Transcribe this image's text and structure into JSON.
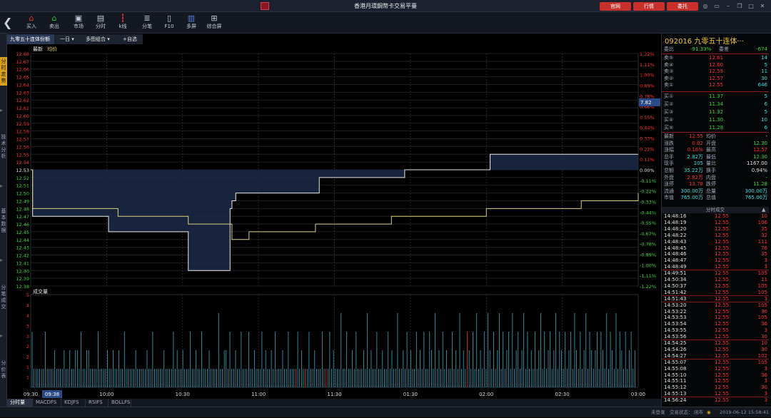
{
  "titlebar": {
    "title": "香港月環鋼幣卡交易平臺",
    "btn_official": "官网",
    "btn_market": "行情",
    "btn_trade": "委托"
  },
  "toolbar": [
    {
      "label": "买入",
      "icon": "buy-icon",
      "color": "#e83030"
    },
    {
      "label": "卖出",
      "icon": "sell-icon",
      "color": "#30c030"
    },
    {
      "label": "市场",
      "icon": "market-icon",
      "color": "#c0c8d8"
    },
    {
      "label": "分时",
      "icon": "timeline-icon",
      "color": "#c0c8d8"
    },
    {
      "label": "k线",
      "icon": "candlestick-icon",
      "color": "#e83030"
    },
    {
      "label": "分笔",
      "icon": "ticks-icon",
      "color": "#c0c8d8"
    },
    {
      "label": "F10",
      "icon": "f10-icon",
      "color": "#c0c8d8"
    },
    {
      "label": "多屏",
      "icon": "multiscreen-icon",
      "color": "#5080e0"
    },
    {
      "label": "综合屏",
      "icon": "composite-icon",
      "color": "#c0c8d8"
    }
  ],
  "leftnav": [
    "分时走势",
    "技术分析",
    "基本数据",
    "分笔成交",
    "分价表"
  ],
  "chart_header": {
    "name": "九零五十连体份额",
    "period": "一日",
    "combo": "多图组合",
    "add": "+自选"
  },
  "legend": {
    "latest": "最新",
    "avg": "均价"
  },
  "volume_label": "成交量",
  "cursor_value": "7.82",
  "time_cursor": "09:38",
  "chart_data": {
    "type": "line",
    "price_ticks": [
      "12.68",
      "12.67",
      "12.66",
      "12.65",
      "12.64",
      "12.63",
      "12.62",
      "12.61",
      "12.60",
      "12.59",
      "12.58",
      "12.57",
      "12.56",
      "12.55",
      "12.54",
      "12.53",
      "12.52",
      "12.51",
      "12.50",
      "12.49",
      "12.48",
      "12.47",
      "12.46",
      "12.45",
      "12.44",
      "12.43",
      "12.42",
      "12.41",
      "12.40",
      "12.39",
      "12.38"
    ],
    "pct_ticks": [
      "1.22%",
      "1.11%",
      "1.00%",
      "0.89%",
      "0.78%",
      "0.66%",
      "0.55%",
      "0.44%",
      "0.33%",
      "0.22%",
      "0.11%",
      "0.00%",
      "-0.11%",
      "-0.22%",
      "-0.33%",
      "-0.44%",
      "-0.55%",
      "-0.67%",
      "-0.78%",
      "-0.89%",
      "-1.00%",
      "-1.11%",
      "-1.22%"
    ],
    "vol_ticks": [
      "5",
      "4",
      "4",
      "3",
      "3",
      "2",
      "2",
      "1",
      "1"
    ],
    "xticks": [
      "09:30",
      "10:00",
      "10:30",
      "11:00",
      "11:30",
      "01:30",
      "02:00",
      "02:30",
      "03:00"
    ],
    "ylim": [
      12.38,
      12.68
    ],
    "series": [
      {
        "color": "#e8e8e8",
        "values": [
          [
            0,
            12.53
          ],
          [
            1,
            12.47
          ],
          [
            40,
            12.47
          ],
          [
            41,
            12.45
          ],
          [
            82,
            12.45
          ],
          [
            83,
            12.4
          ],
          [
            104,
            12.4
          ],
          [
            105,
            12.48
          ],
          [
            106,
            12.49
          ],
          [
            108,
            12.5
          ],
          [
            150,
            12.5
          ],
          [
            152,
            12.52
          ],
          [
            195,
            12.52
          ],
          [
            197,
            12.53
          ],
          [
            240,
            12.53
          ],
          [
            242,
            12.55
          ],
          [
            320,
            12.55
          ]
        ]
      },
      {
        "color": "#d8d080",
        "values": [
          [
            0,
            12.53
          ],
          [
            1,
            12.48
          ],
          [
            40,
            12.48
          ],
          [
            46,
            12.47
          ],
          [
            70,
            12.47
          ],
          [
            83,
            12.46
          ],
          [
            104,
            12.46
          ],
          [
            106,
            12.44
          ],
          [
            115,
            12.45
          ],
          [
            150,
            12.46
          ],
          [
            190,
            12.47
          ],
          [
            240,
            12.48
          ],
          [
            290,
            12.49
          ],
          [
            320,
            12.5
          ]
        ]
      }
    ],
    "volume": [
      3,
      1,
      1,
      1,
      1,
      1,
      1,
      3,
      1,
      1,
      1,
      1,
      2,
      1,
      1,
      1,
      1,
      2,
      1,
      1,
      2,
      1,
      1,
      2,
      2,
      1,
      3,
      1,
      1,
      2,
      2,
      1,
      1,
      1,
      1,
      3,
      1,
      1,
      1,
      1,
      2,
      1,
      1,
      2,
      1,
      1,
      2,
      1,
      1,
      3,
      1,
      1,
      1,
      1,
      1,
      2,
      1,
      1,
      1,
      1,
      1,
      2,
      1,
      1,
      3,
      1,
      1,
      1,
      1,
      1,
      2,
      1,
      1,
      1,
      1,
      3,
      1,
      2,
      1,
      1,
      2,
      1,
      1,
      1,
      3,
      1,
      1,
      2,
      1,
      1,
      3,
      1,
      1,
      1,
      2,
      1,
      1,
      1,
      1,
      4,
      1,
      1,
      2,
      2,
      1,
      3,
      1,
      1,
      2,
      1,
      1,
      3,
      1,
      1,
      1,
      3,
      1,
      1,
      2,
      1,
      1,
      1,
      3,
      1,
      2,
      1,
      1,
      2,
      1,
      3,
      1,
      1,
      1,
      2,
      1,
      1,
      3,
      1,
      1,
      1,
      1,
      3,
      1,
      2,
      1,
      1,
      1,
      3,
      1,
      1,
      2,
      1,
      1,
      1,
      3,
      1,
      1,
      1,
      3,
      1,
      2,
      1,
      1,
      1,
      4,
      1,
      1,
      3,
      1,
      1,
      2,
      1,
      3,
      1,
      1,
      1,
      2,
      1,
      4,
      1,
      2,
      1,
      1,
      3,
      1,
      1,
      2,
      1,
      1,
      3,
      1,
      2,
      1,
      1,
      4,
      1,
      1,
      2,
      1,
      3,
      1,
      2,
      1,
      1,
      3,
      1,
      2,
      1,
      3,
      1,
      1,
      3,
      2,
      1,
      4,
      1,
      2,
      1,
      3,
      1,
      2,
      1,
      1,
      3,
      1,
      2,
      1,
      4,
      1,
      2,
      1,
      3,
      2,
      1,
      3,
      1,
      4,
      1,
      2,
      1,
      3,
      1,
      4,
      2,
      1,
      3,
      1,
      2,
      4,
      1,
      3,
      1,
      2,
      3,
      1,
      4,
      1,
      2,
      3,
      1,
      2,
      4,
      1,
      3,
      1,
      2,
      1,
      3,
      1,
      2,
      4,
      1,
      3,
      1,
      2,
      3,
      1,
      2,
      4,
      1,
      3,
      2,
      1,
      3,
      1,
      2,
      3,
      1,
      4,
      2,
      1,
      3,
      1,
      2,
      4,
      1,
      3,
      2,
      1,
      2,
      3,
      1,
      3,
      2,
      1,
      4,
      1,
      3,
      2,
      1,
      4,
      1,
      3,
      2,
      1,
      3,
      1,
      2,
      3,
      1,
      2
    ]
  },
  "right": {
    "code_name": "092016 九零五十连体···",
    "weibi": {
      "label": "委比",
      "value": "-91.33%",
      "label2": "委差",
      "value2": "-674"
    },
    "sells": [
      {
        "label": "卖⑤",
        "price": "12.61",
        "vol": "14"
      },
      {
        "label": "卖④",
        "price": "12.60",
        "vol": "5"
      },
      {
        "label": "卖③",
        "price": "12.59",
        "vol": "11"
      },
      {
        "label": "卖②",
        "price": "12.57",
        "vol": "30"
      },
      {
        "label": "卖①",
        "price": "12.55",
        "vol": "646"
      }
    ],
    "buys": [
      {
        "label": "买①",
        "price": "11.37",
        "vol": "5"
      },
      {
        "label": "买②",
        "price": "11.34",
        "vol": "6"
      },
      {
        "label": "买③",
        "price": "11.32",
        "vol": "5"
      },
      {
        "label": "买④",
        "price": "11.30",
        "vol": "10"
      },
      {
        "label": "买⑤",
        "price": "11.28",
        "vol": "6"
      }
    ],
    "stats": [
      {
        "l1": "最新",
        "v1": "12.55",
        "c1": "red",
        "l2": "均价",
        "v2": "-",
        "c2": "white"
      },
      {
        "l1": "涨跌",
        "v1": "0.02",
        "c1": "red",
        "l2": "开盘",
        "v2": "12.30",
        "c2": "green"
      },
      {
        "l1": "涨幅",
        "v1": "0.16%",
        "c1": "red",
        "l2": "最高",
        "v2": "12.57",
        "c2": "red"
      },
      {
        "l1": "总手",
        "v1": "2.82万",
        "c1": "cyan",
        "l2": "最低",
        "v2": "12.30",
        "c2": "green"
      },
      {
        "l1": "现手",
        "v1": "105",
        "c1": "cyan",
        "l2": "量比",
        "v2": "1167.00",
        "c2": "white"
      },
      {
        "l1": "总额",
        "v1": "35.22万",
        "c1": "cyan",
        "l2": "换手",
        "v2": "0.94%",
        "c2": "white"
      },
      {
        "l1": "外盘",
        "v1": "2.82万",
        "c1": "red",
        "l2": "内盘",
        "v2": "-",
        "c2": "green"
      },
      {
        "l1": "涨停",
        "v1": "13.78",
        "c1": "red",
        "l2": "跌停",
        "v2": "11.28",
        "c2": "green"
      },
      {
        "l1": "流通",
        "v1": "300.00万",
        "c1": "cyan",
        "l2": "总量",
        "v2": "300.00万",
        "c2": "cyan"
      },
      {
        "l1": "市值",
        "v1": "765.00万",
        "c1": "cyan",
        "l2": "总值",
        "v2": "765.00万",
        "c2": "cyan"
      }
    ],
    "trades_header": "分时成交",
    "trades": [
      {
        "t": "14:48:16",
        "p": "12.55",
        "v": "10"
      },
      {
        "t": "14:48:19",
        "p": "12.55",
        "v": "106"
      },
      {
        "t": "14:48:20",
        "p": "12.55",
        "v": "35"
      },
      {
        "t": "14:48:22",
        "p": "12.55",
        "v": "32"
      },
      {
        "t": "14:48:43",
        "p": "12.55",
        "v": "111"
      },
      {
        "t": "14:48:45",
        "p": "12.55",
        "v": "76"
      },
      {
        "t": "14:48:46",
        "p": "12.55",
        "v": "35"
      },
      {
        "t": "14:48:47",
        "p": "12.55",
        "v": "3"
      },
      {
        "t": "14:48:49",
        "p": "12.55",
        "v": "3"
      },
      {
        "t": "14:49:51",
        "p": "12.55",
        "v": "105"
      },
      {
        "t": "14:50:34",
        "p": "12.55",
        "v": "11"
      },
      {
        "t": "14:50:37",
        "p": "12.55",
        "v": "105"
      },
      {
        "t": "14:51:42",
        "p": "12.55",
        "v": "105"
      },
      {
        "t": "14:51:43",
        "p": "12.55",
        "v": "3"
      },
      {
        "t": "14:53:20",
        "p": "12.55",
        "v": "105"
      },
      {
        "t": "14:53:22",
        "p": "12.55",
        "v": "30"
      },
      {
        "t": "14:53:53",
        "p": "12.55",
        "v": "105"
      },
      {
        "t": "14:53:54",
        "p": "12.55",
        "v": "36"
      },
      {
        "t": "14:53:55",
        "p": "12.55",
        "v": "3"
      },
      {
        "t": "14:53:56",
        "p": "12.55",
        "v": "30"
      },
      {
        "t": "14:54:25",
        "p": "12.55",
        "v": "10"
      },
      {
        "t": "14:54:26",
        "p": "12.55",
        "v": "30"
      },
      {
        "t": "14:54:27",
        "p": "12.55",
        "v": "102"
      },
      {
        "t": "14:55:07",
        "p": "12.55",
        "v": "105"
      },
      {
        "t": "14:55:08",
        "p": "12.55",
        "v": "3"
      },
      {
        "t": "14:55:10",
        "p": "12.55",
        "v": "36"
      },
      {
        "t": "14:55:11",
        "p": "12.55",
        "v": "3"
      },
      {
        "t": "14:55:12",
        "p": "12.55",
        "v": "30"
      },
      {
        "t": "14:55:13",
        "p": "12.55",
        "v": "3"
      },
      {
        "t": "14:56:24",
        "p": "12.55",
        "v": "3"
      }
    ]
  },
  "bottom_tabs": [
    "分时量",
    "MACDFS",
    "KDJFS",
    "RSIFS",
    "BOLLFS"
  ],
  "status": {
    "s1": "未登录",
    "s2": "交易状态：",
    "s3": "闭市",
    "time": "2019-06-12 15:58:41"
  }
}
